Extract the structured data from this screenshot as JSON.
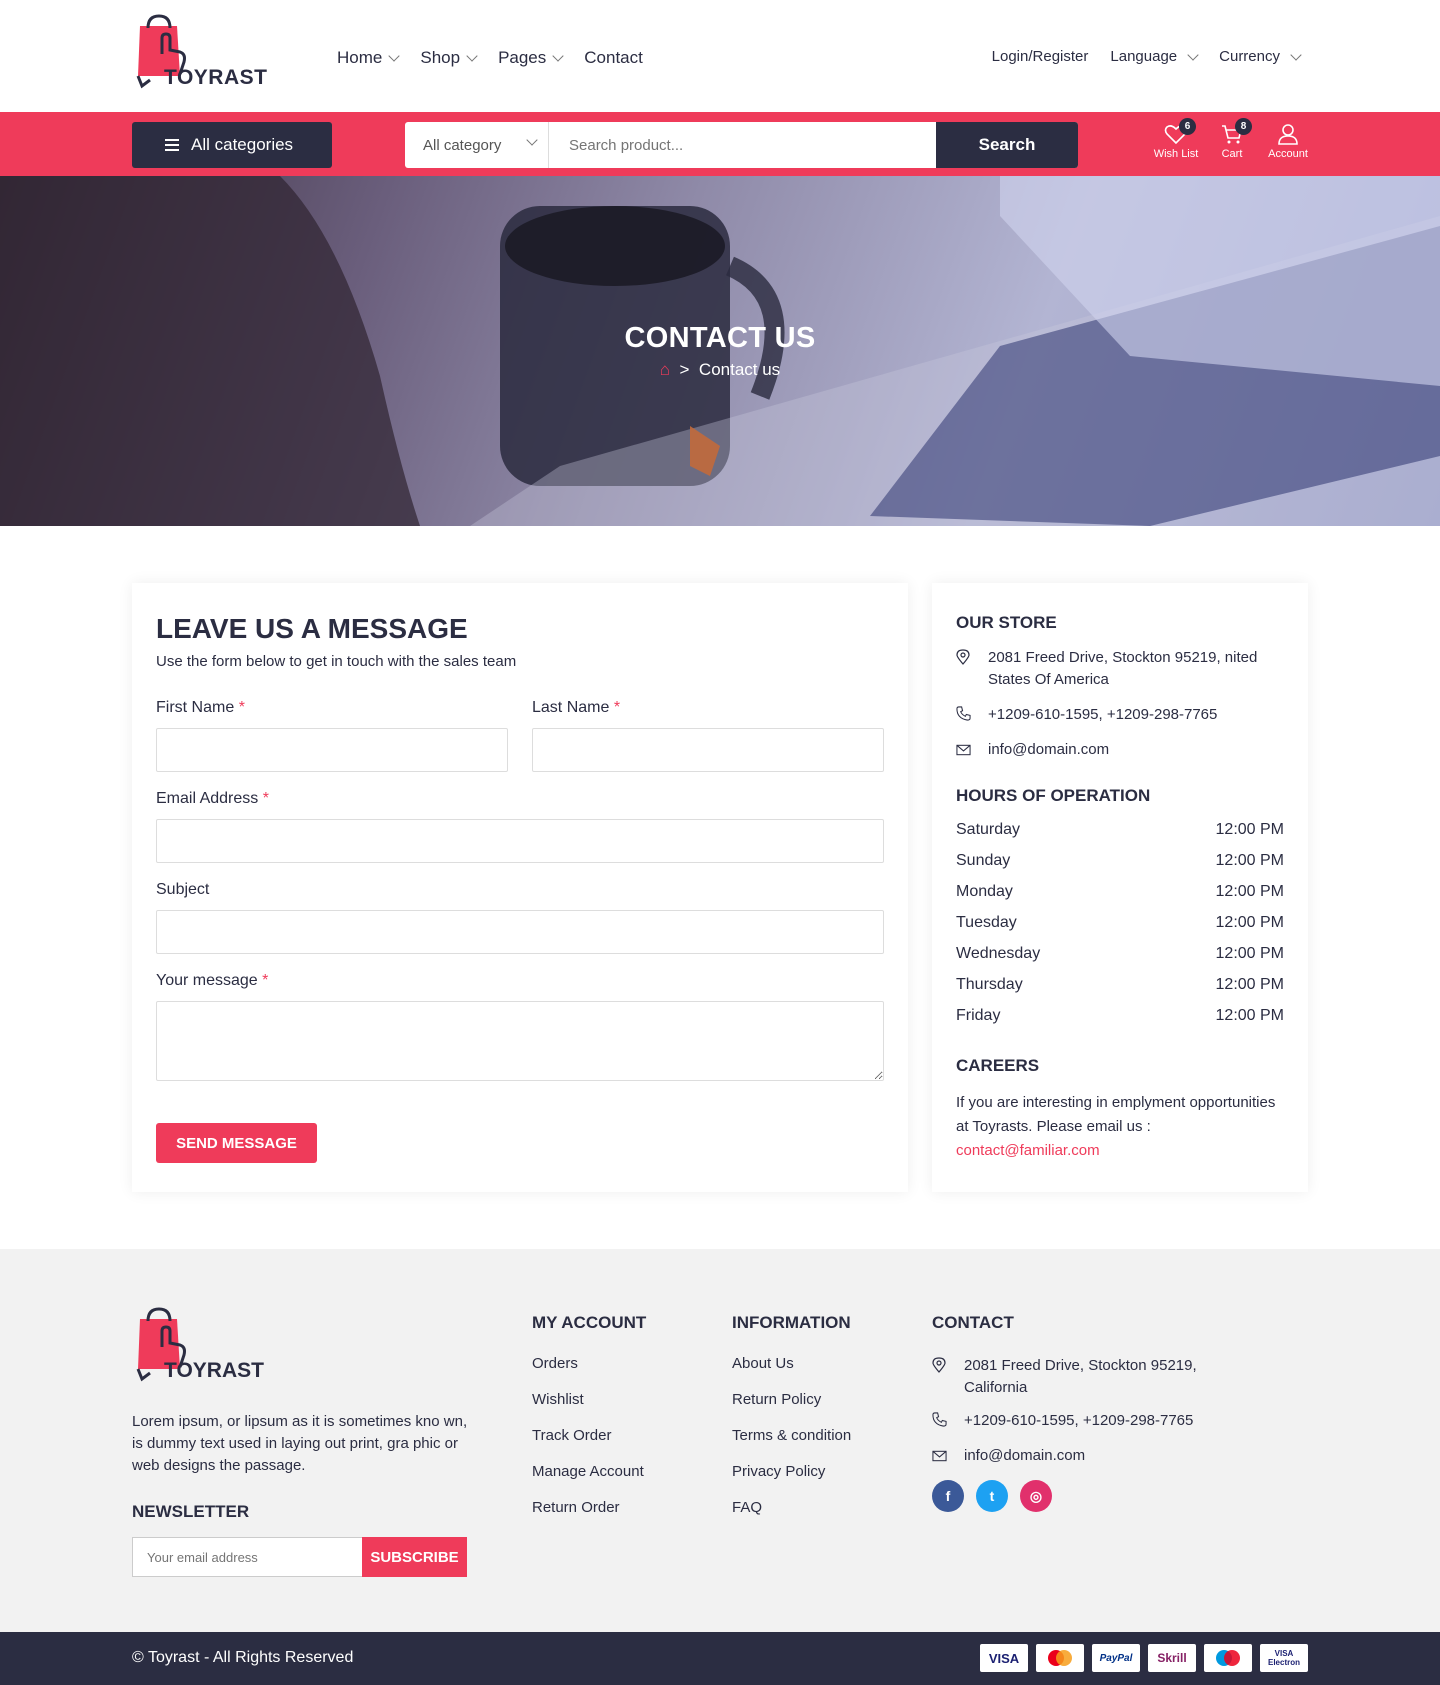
{
  "brand": {
    "name": "TOYRAST",
    "accent": "#ef3b5a",
    "dark": "#2b2d42"
  },
  "nav": {
    "items": [
      {
        "label": "Home",
        "has_dropdown": true
      },
      {
        "label": "Shop",
        "has_dropdown": true
      },
      {
        "label": "Pages",
        "has_dropdown": true
      },
      {
        "label": "Contact",
        "has_dropdown": false
      }
    ],
    "login": "Login/Register",
    "language": "Language",
    "currency": "Currency"
  },
  "searchbar": {
    "all_categories": "All categories",
    "category_select": "All category",
    "placeholder": "Search product...",
    "search_button": "Search"
  },
  "header_icons": {
    "wishlist": {
      "label": "Wish List",
      "count": "6"
    },
    "cart": {
      "label": "Cart",
      "count": "8"
    },
    "account": {
      "label": "Account"
    }
  },
  "hero": {
    "title": "CONTACT US",
    "breadcrumb_current": "Contact us"
  },
  "form": {
    "title": "LEAVE US A MESSAGE",
    "subtitle": "Use the form below to get in touch with the sales team",
    "first_name": "First Name",
    "last_name": "Last Name",
    "email": "Email Address",
    "subject": "Subject",
    "message": "Your message",
    "required_mark": "*",
    "send_button": "SEND MESSAGE"
  },
  "store": {
    "title": "OUR STORE",
    "address": "2081 Freed Drive, Stockton 95219, nited States Of America",
    "phone": "+1209-610-1595, +1209-298-7765",
    "email": "info@domain.com",
    "hours_title": "HOURS OF OPERATION",
    "hours": [
      {
        "day": "Saturday",
        "time": "12:00 PM"
      },
      {
        "day": "Sunday",
        "time": "12:00 PM"
      },
      {
        "day": "Monday",
        "time": "12:00 PM"
      },
      {
        "day": "Tuesday",
        "time": "12:00 PM"
      },
      {
        "day": "Wednesday",
        "time": "12:00 PM"
      },
      {
        "day": "Thursday",
        "time": "12:00 PM"
      },
      {
        "day": "Friday",
        "time": "12:00 PM"
      }
    ],
    "careers_title": "CAREERS",
    "careers_text": "If you are interesting in emplyment opportunities at Toyrasts. Please email us :",
    "careers_email": "contact@familiar.com"
  },
  "footer": {
    "description": "Lorem ipsum, or lipsum as it is sometimes kno wn, is dummy text used in laying out print, gra phic or web designs the passage.",
    "newsletter_title": "NEWSLETTER",
    "newsletter_placeholder": "Your email address",
    "subscribe": "SUBSCRIBE",
    "my_account": {
      "title": "MY ACCOUNT",
      "links": [
        "Orders",
        "Wishlist",
        "Track Order",
        "Manage Account",
        "Return Order"
      ]
    },
    "information": {
      "title": "INFORMATION",
      "links": [
        "About Us",
        "Return Policy",
        "Terms & condition",
        "Privacy Policy",
        "FAQ"
      ]
    },
    "contact": {
      "title": "CONTACT",
      "address": "2081 Freed Drive, Stockton 95219, California",
      "phone": "+1209-610-1595, +1209-298-7765",
      "email": "info@domain.com"
    },
    "social": [
      {
        "name": "facebook-icon",
        "glyph": "f",
        "color": "#3b5998"
      },
      {
        "name": "twitter-icon",
        "glyph": "t",
        "color": "#1da1f2"
      },
      {
        "name": "instagram-icon",
        "glyph": "◎",
        "color": "#e1306c"
      }
    ],
    "copyright": "© Toyrast - All Rights Reserved",
    "payments": [
      "VISA",
      "Mastercard",
      "PayPal",
      "Skrill",
      "Maestro",
      "VISA Electron"
    ]
  }
}
